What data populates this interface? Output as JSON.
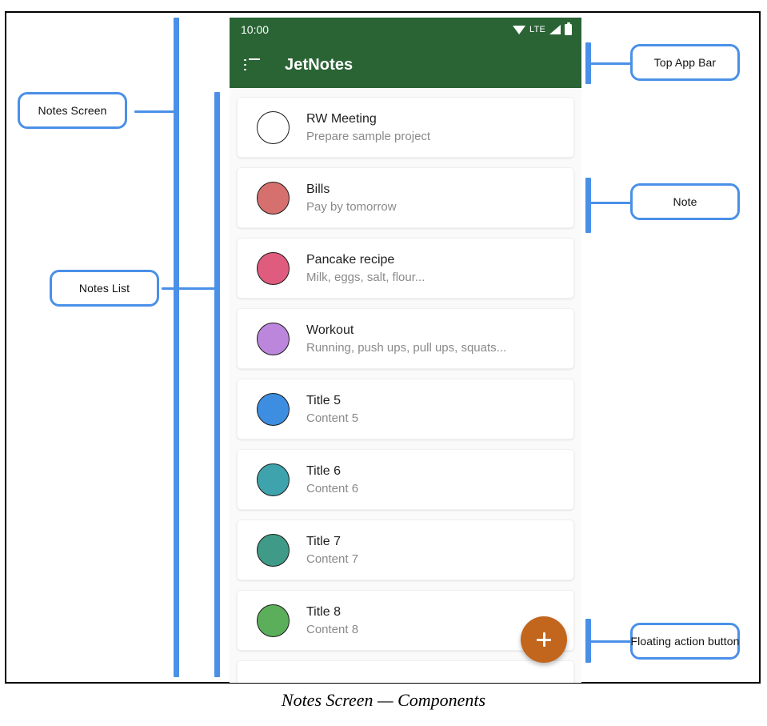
{
  "caption": "Notes Screen — Components",
  "colors": {
    "accent_blue": "#4a90e8",
    "app_bar_green": "#2a6435",
    "fab_orange": "#c2651d"
  },
  "phone": {
    "status_bar": {
      "time": "10:00",
      "network_label": "LTE",
      "icons": [
        "wifi-icon",
        "signal-icon",
        "battery-icon"
      ]
    },
    "app_bar": {
      "menu_icon": "list-icon",
      "title": "JetNotes"
    },
    "notes": [
      {
        "title": "RW Meeting",
        "content": "Prepare sample project",
        "color": "#ffffff"
      },
      {
        "title": "Bills",
        "content": "Pay by tomorrow",
        "color": "#d6706f"
      },
      {
        "title": "Pancake recipe",
        "content": "Milk, eggs, salt, flour...",
        "color": "#e05c7e"
      },
      {
        "title": "Workout",
        "content": "Running, push ups, pull ups, squats...",
        "color": "#bb86dc"
      },
      {
        "title": "Title 5",
        "content": "Content 5",
        "color": "#3d8ee0"
      },
      {
        "title": "Title 6",
        "content": "Content 6",
        "color": "#3fa3ad"
      },
      {
        "title": "Title 7",
        "content": "Content 7",
        "color": "#3f9b87"
      },
      {
        "title": "Title 8",
        "content": "Content 8",
        "color": "#5caf5a"
      },
      {
        "title": "",
        "content": "",
        "color": "#ffffff"
      }
    ],
    "fab": {
      "icon": "plus-icon",
      "label": "+"
    }
  },
  "annotations": {
    "left": [
      {
        "label": "Notes Screen",
        "name": "callout-notes-screen"
      },
      {
        "label": "Notes List",
        "name": "callout-notes-list"
      }
    ],
    "right": [
      {
        "label": "Top App Bar",
        "name": "callout-top-app-bar"
      },
      {
        "label": "Note",
        "name": "callout-note"
      },
      {
        "label": "Floating action button",
        "name": "callout-floating-action-button"
      }
    ]
  }
}
